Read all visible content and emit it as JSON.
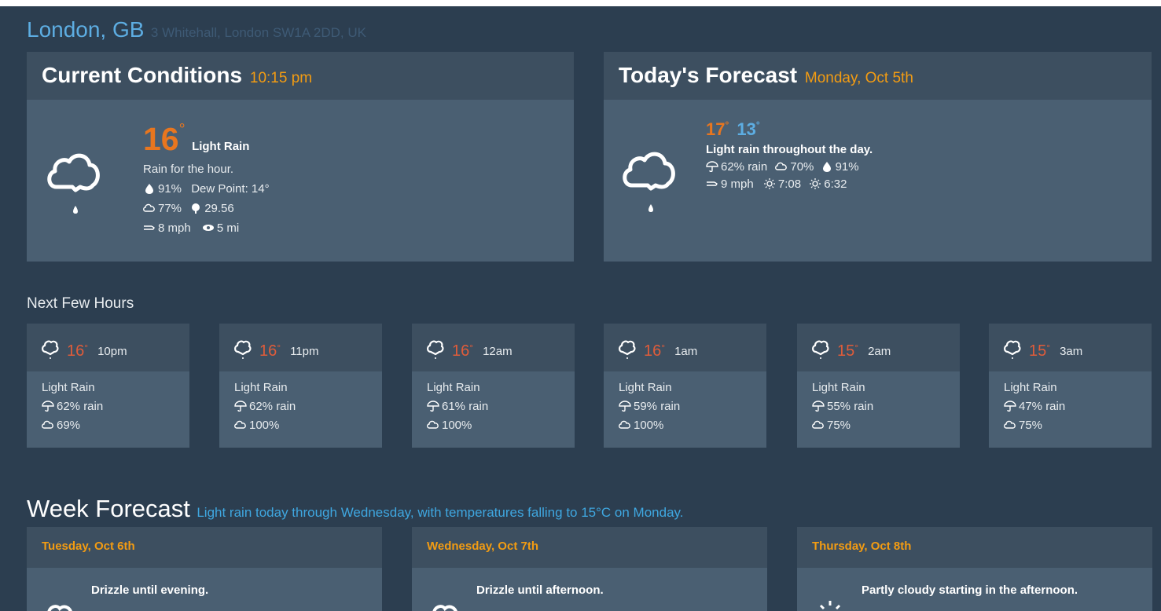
{
  "location": {
    "city": "London, GB",
    "address": "3 Whitehall, London SW1A 2DD, UK"
  },
  "current": {
    "title": "Current Conditions",
    "time": "10:15 pm",
    "temp": "16",
    "condition": "Light Rain",
    "summary": "Rain for the hour.",
    "humidity": "91%",
    "dew_point": "Dew Point: 14°",
    "cloud_cover": "77%",
    "pressure": "29.56",
    "wind": "8 mph",
    "visibility": "5 mi",
    "icon": "rain-cloud-icon"
  },
  "today": {
    "title": "Today's Forecast",
    "date": "Monday, Oct 5th",
    "high": "17",
    "low": "13",
    "summary": "Light rain throughout the day.",
    "rain_chance": "62% rain",
    "cloud_cover": "70%",
    "humidity": "91%",
    "wind": "9 mph",
    "sunrise": "7:08",
    "sunset": "6:32",
    "icon": "rain-cloud-icon"
  },
  "hours_label": "Next Few Hours",
  "hours": [
    {
      "temp": "16",
      "time": "10pm",
      "condition": "Light Rain",
      "rain": "62% rain",
      "cloud": "69%"
    },
    {
      "temp": "16",
      "time": "11pm",
      "condition": "Light Rain",
      "rain": "62% rain",
      "cloud": "100%"
    },
    {
      "temp": "16",
      "time": "12am",
      "condition": "Light Rain",
      "rain": "61% rain",
      "cloud": "100%"
    },
    {
      "temp": "16",
      "time": "1am",
      "condition": "Light Rain",
      "rain": "59% rain",
      "cloud": "100%"
    },
    {
      "temp": "15",
      "time": "2am",
      "condition": "Light Rain",
      "rain": "55% rain",
      "cloud": "75%"
    },
    {
      "temp": "15",
      "time": "3am",
      "condition": "Light Rain",
      "rain": "47% rain",
      "cloud": "75%"
    }
  ],
  "week": {
    "title": "Week Forecast",
    "summary": "Light rain today through Wednesday, with temperatures falling to 15°C on Monday.",
    "days": [
      {
        "date": "Tuesday, Oct 6th",
        "summary": "Drizzle until evening.",
        "icon": "rain-cloud-icon"
      },
      {
        "date": "Wednesday, Oct 7th",
        "summary": "Drizzle until afternoon.",
        "icon": "rain-cloud-icon"
      },
      {
        "date": "Thursday, Oct 8th",
        "summary": "Partly cloudy starting in the afternoon.",
        "icon": "sun-icon"
      }
    ]
  },
  "colors": {
    "background": "#2c3e50",
    "card": "#4a5f72",
    "card_header": "#3d4f60",
    "temp": "#e8761f",
    "accent": "#f39c12",
    "link": "#5dade2"
  }
}
